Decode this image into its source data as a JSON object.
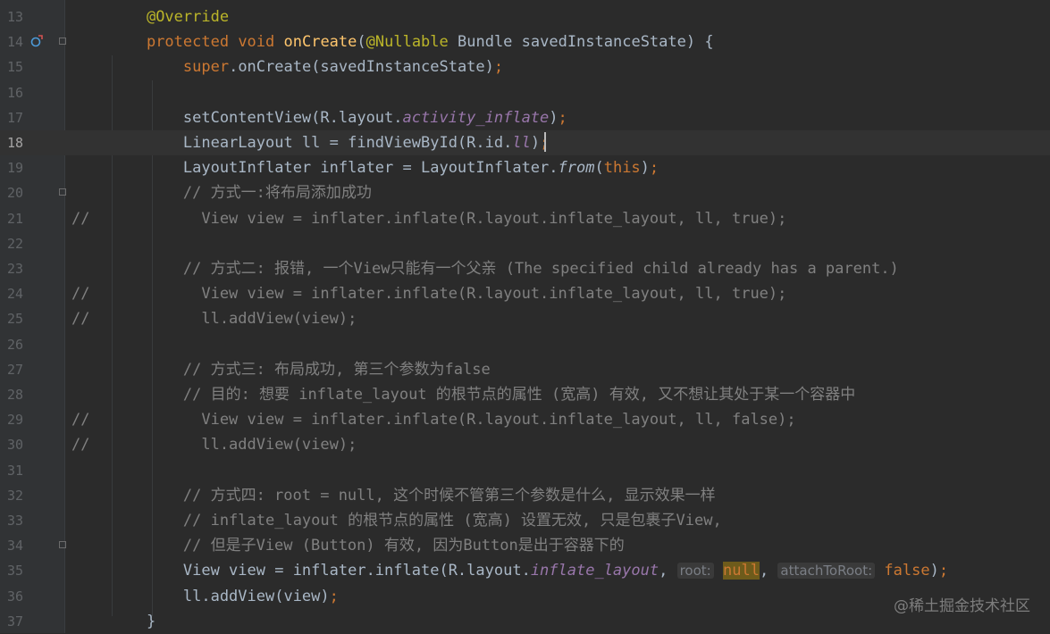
{
  "editor": {
    "lines": [
      {
        "num": "13",
        "mark": "",
        "tokens": [
          {
            "t": "    ",
            "c": "def"
          },
          {
            "t": "@Override",
            "c": "ann"
          }
        ]
      },
      {
        "num": "14",
        "mark": "",
        "tokens": [
          {
            "t": "    ",
            "c": "def"
          },
          {
            "t": "protected ",
            "c": "kw"
          },
          {
            "t": "void ",
            "c": "kw"
          },
          {
            "t": "onCreate",
            "c": "fn"
          },
          {
            "t": "(",
            "c": "def"
          },
          {
            "t": "@Nullable ",
            "c": "ann"
          },
          {
            "t": "Bundle savedInstanceState) {",
            "c": "def"
          }
        ]
      },
      {
        "num": "15",
        "mark": "",
        "tokens": [
          {
            "t": "        ",
            "c": "def"
          },
          {
            "t": "super",
            "c": "kw"
          },
          {
            "t": ".onCreate(savedInstanceState)",
            "c": "def"
          },
          {
            "t": ";",
            "c": "kw"
          }
        ]
      },
      {
        "num": "16",
        "mark": "",
        "tokens": []
      },
      {
        "num": "17",
        "mark": "",
        "tokens": [
          {
            "t": "        setContentView(R.layout.",
            "c": "def"
          },
          {
            "t": "activity_inflate",
            "c": "field"
          },
          {
            "t": ")",
            "c": "def"
          },
          {
            "t": ";",
            "c": "kw"
          }
        ]
      },
      {
        "num": "18",
        "mark": "",
        "tokens": [
          {
            "t": "        LinearLayout ll = findViewById(R.id.",
            "c": "def"
          },
          {
            "t": "ll",
            "c": "field"
          },
          {
            "t": ")",
            "c": "def"
          },
          {
            "t": ";",
            "c": "kw"
          }
        ]
      },
      {
        "num": "19",
        "mark": "",
        "tokens": [
          {
            "t": "        LayoutInflater inflater = LayoutInflater.",
            "c": "def"
          },
          {
            "t": "from",
            "c": "st"
          },
          {
            "t": "(",
            "c": "def"
          },
          {
            "t": "this",
            "c": "kw"
          },
          {
            "t": ")",
            "c": "def"
          },
          {
            "t": ";",
            "c": "kw"
          }
        ]
      },
      {
        "num": "20",
        "mark": "",
        "tokens": [
          {
            "t": "        // 方式一:将布局添加成功",
            "c": "cm"
          }
        ]
      },
      {
        "num": "21",
        "mark": "//",
        "tokens": [
          {
            "t": "          View view = inflater.inflate(R.layout.inflate_layout, ll, true);",
            "c": "cm"
          }
        ]
      },
      {
        "num": "22",
        "mark": "",
        "tokens": []
      },
      {
        "num": "23",
        "mark": "",
        "tokens": [
          {
            "t": "        // 方式二: 报错, 一个View只能有一个父亲 (The specified child already has a parent.)",
            "c": "cm"
          }
        ]
      },
      {
        "num": "24",
        "mark": "//",
        "tokens": [
          {
            "t": "          View view = inflater.inflate(R.layout.inflate_layout, ll, true);",
            "c": "cm"
          }
        ]
      },
      {
        "num": "25",
        "mark": "//",
        "tokens": [
          {
            "t": "          ll.addView(view);",
            "c": "cm"
          }
        ]
      },
      {
        "num": "26",
        "mark": "",
        "tokens": []
      },
      {
        "num": "27",
        "mark": "",
        "tokens": [
          {
            "t": "        // 方式三: 布局成功, 第三个参数为false",
            "c": "cm"
          }
        ]
      },
      {
        "num": "28",
        "mark": "",
        "tokens": [
          {
            "t": "        // 目的: 想要 inflate_layout 的根节点的属性 (宽高) 有效, 又不想让其处于某一个容器中",
            "c": "cm"
          }
        ]
      },
      {
        "num": "29",
        "mark": "//",
        "tokens": [
          {
            "t": "          View view = inflater.inflate(R.layout.inflate_layout, ll, false);",
            "c": "cm"
          }
        ]
      },
      {
        "num": "30",
        "mark": "//",
        "tokens": [
          {
            "t": "          ll.addView(view);",
            "c": "cm"
          }
        ]
      },
      {
        "num": "31",
        "mark": "",
        "tokens": []
      },
      {
        "num": "32",
        "mark": "",
        "tokens": [
          {
            "t": "        // 方式四: root = null, 这个时候不管第三个参数是什么, 显示效果一样",
            "c": "cm"
          }
        ]
      },
      {
        "num": "33",
        "mark": "",
        "tokens": [
          {
            "t": "        // inflate_layout 的根节点的属性 (宽高) 设置无效, 只是包裹子View,",
            "c": "cm"
          }
        ]
      },
      {
        "num": "34",
        "mark": "",
        "tokens": [
          {
            "t": "        // 但是子View (Button) 有效, 因为Button是出于容器下的",
            "c": "cm"
          }
        ]
      },
      {
        "num": "35",
        "mark": "",
        "tokens": [
          {
            "t": "        View view = inflater.inflate(R.layout.",
            "c": "def"
          },
          {
            "t": "inflate_layout",
            "c": "field"
          },
          {
            "t": ", ",
            "c": "def"
          },
          {
            "t": "root:",
            "c": "hint"
          },
          {
            "t": " ",
            "c": "def"
          },
          {
            "t": "null",
            "c": "null"
          },
          {
            "t": ", ",
            "c": "def"
          },
          {
            "t": "attachToRoot:",
            "c": "hint"
          },
          {
            "t": " ",
            "c": "def"
          },
          {
            "t": "false",
            "c": "kw"
          },
          {
            "t": ")",
            "c": "def"
          },
          {
            "t": ";",
            "c": "kw"
          }
        ]
      },
      {
        "num": "36",
        "mark": "",
        "tokens": [
          {
            "t": "        ll.addView(view)",
            "c": "def"
          },
          {
            "t": ";",
            "c": "kw"
          }
        ]
      },
      {
        "num": "37",
        "mark": "",
        "tokens": [
          {
            "t": "    }",
            "c": "def"
          }
        ]
      }
    ],
    "current_line": "18",
    "fold_markers_on": [
      "14",
      "20",
      "34"
    ],
    "override_icon_on": "14"
  },
  "watermark": "@稀土掘金技术社区",
  "colors": {
    "background": "#2b2b2b",
    "keyword": "#cc7832",
    "function": "#ffc66d",
    "annotation": "#bbb529",
    "comment": "#808080",
    "field": "#9876aa"
  }
}
